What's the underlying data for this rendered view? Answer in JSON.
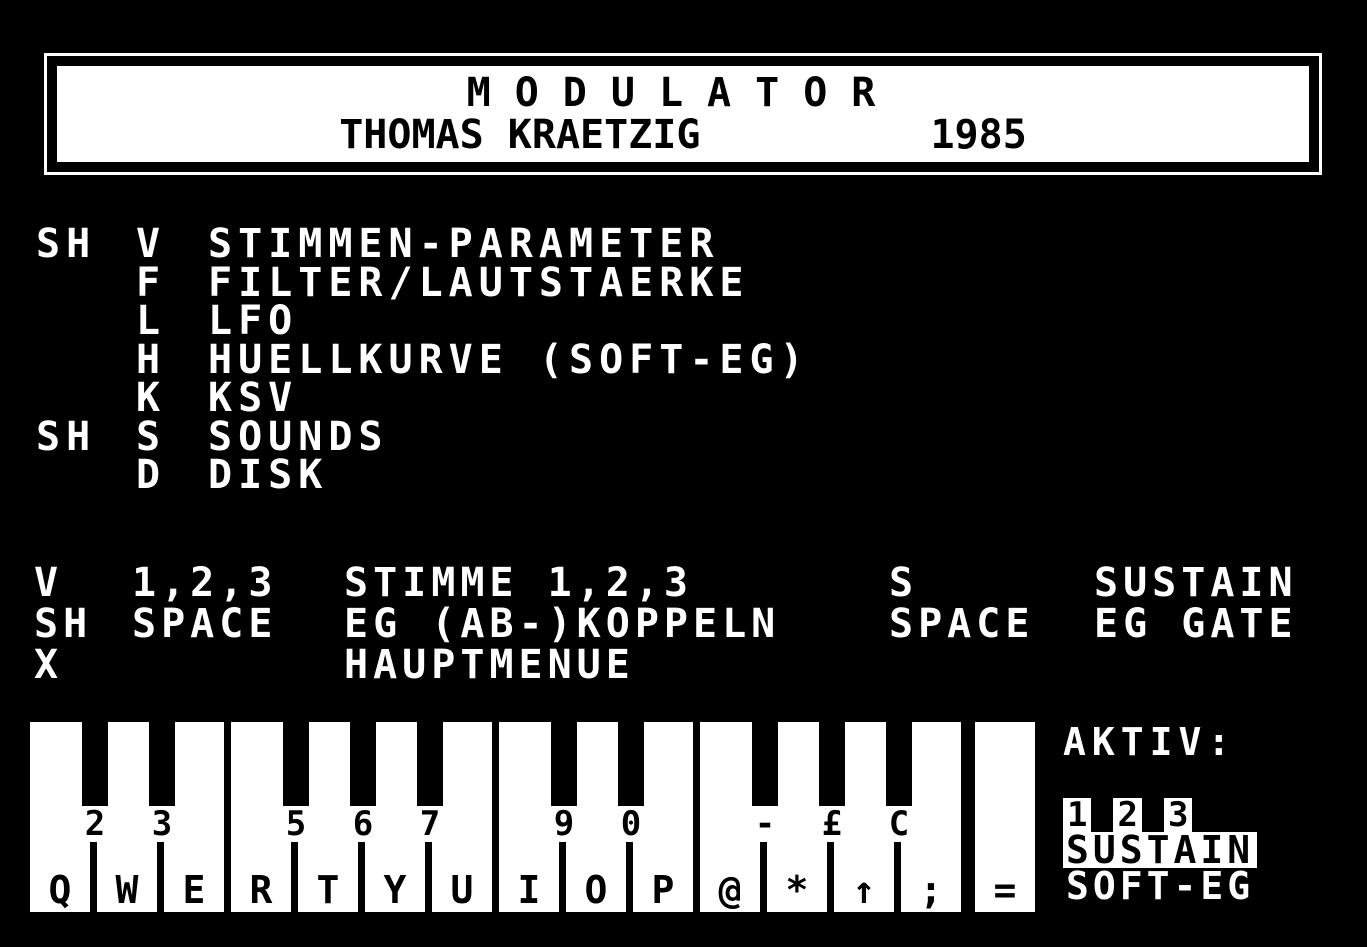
{
  "title": {
    "line1": "MODULATOR",
    "author": "THOMAS KRAETZIG",
    "year": "1985"
  },
  "menu": [
    {
      "mod": "SH",
      "key": "V",
      "label": "STIMMEN-PARAMETER"
    },
    {
      "mod": "",
      "key": "F",
      "label": "FILTER/LAUTSTAERKE"
    },
    {
      "mod": "",
      "key": "L",
      "label": "LFO"
    },
    {
      "mod": "",
      "key": "H",
      "label": "HUELLKURVE (SOFT-EG)"
    },
    {
      "mod": "",
      "key": "K",
      "label": "KSV"
    },
    {
      "mod": "SH",
      "key": "S",
      "label": "SOUNDS"
    },
    {
      "mod": "",
      "key": "D",
      "label": "DISK"
    }
  ],
  "key_help": [
    {
      "a": "V",
      "b": "1,2,3",
      "c": "STIMME 1,2,3",
      "d": "S",
      "e": "SUSTAIN"
    },
    {
      "a": "SH",
      "b": "SPACE",
      "c": "EG (AB-)KOPPELN",
      "d": "SPACE",
      "e": "EG GATE"
    },
    {
      "a": "X",
      "b": "",
      "c": "HAUPTMENUE",
      "d": "",
      "e": ""
    }
  ],
  "keyboard": {
    "white_keys": [
      "Q",
      "W",
      "E",
      "R",
      "T",
      "Y",
      "U",
      "I",
      "O",
      "P",
      "@",
      "*",
      "↑",
      ";",
      "="
    ],
    "black_keys": [
      "2",
      "3",
      "5",
      "6",
      "7",
      "9",
      "0",
      "-",
      "£",
      "C"
    ]
  },
  "status": {
    "aktiv_label": "AKTIV:",
    "voices": [
      "1",
      "2",
      "3"
    ],
    "sustain": "SUSTAIN",
    "soft_eg": "SOFT-EG"
  }
}
